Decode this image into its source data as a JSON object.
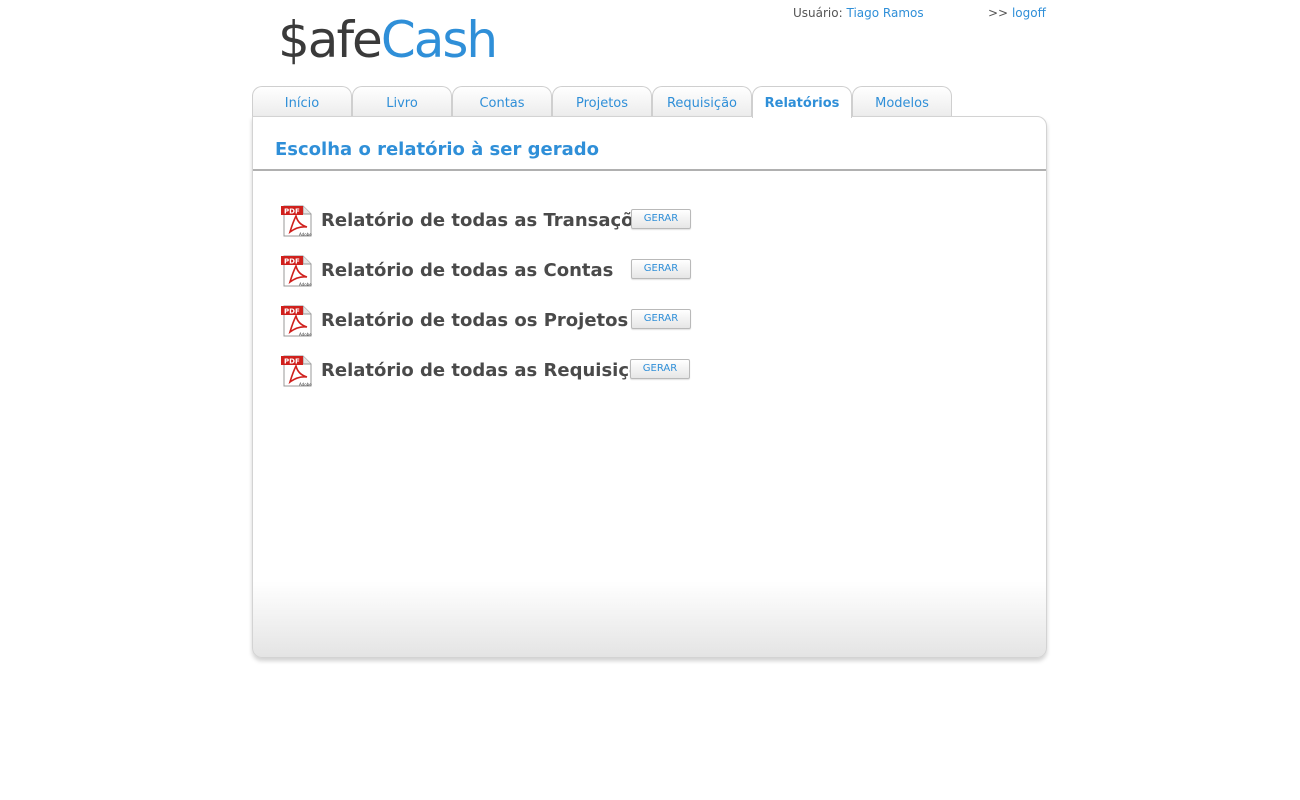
{
  "logo": {
    "part1": "$afe",
    "part2": "Cash"
  },
  "user": {
    "label": "Usuário:",
    "name": "Tiago Ramos"
  },
  "logoff": {
    "prefix": ">>",
    "label": "logoff"
  },
  "tabs": [
    {
      "label": "Início",
      "active": false
    },
    {
      "label": "Livro",
      "active": false
    },
    {
      "label": "Contas",
      "active": false
    },
    {
      "label": "Projetos",
      "active": false
    },
    {
      "label": "Requisição",
      "active": false
    },
    {
      "label": "Relatórios",
      "active": true
    },
    {
      "label": "Modelos",
      "active": false
    }
  ],
  "panel": {
    "title": "Escolha o relatório à ser gerado"
  },
  "reports": [
    {
      "label": "Relatório de todas as Transações",
      "button": "GERAR",
      "icon": "pdf-icon"
    },
    {
      "label": "Relatório de todas as Contas",
      "button": "GERAR",
      "icon": "pdf-icon"
    },
    {
      "label": "Relatório de todas os Projetos",
      "button": "GERAR",
      "icon": "pdf-icon"
    },
    {
      "label": "Relatório de todas as Requisições",
      "button": "GERAR",
      "icon": "pdf-icon"
    }
  ],
  "colors": {
    "accent": "#2f8fd8",
    "text": "#4a4a4a",
    "pdf_red": "#d0201c"
  }
}
